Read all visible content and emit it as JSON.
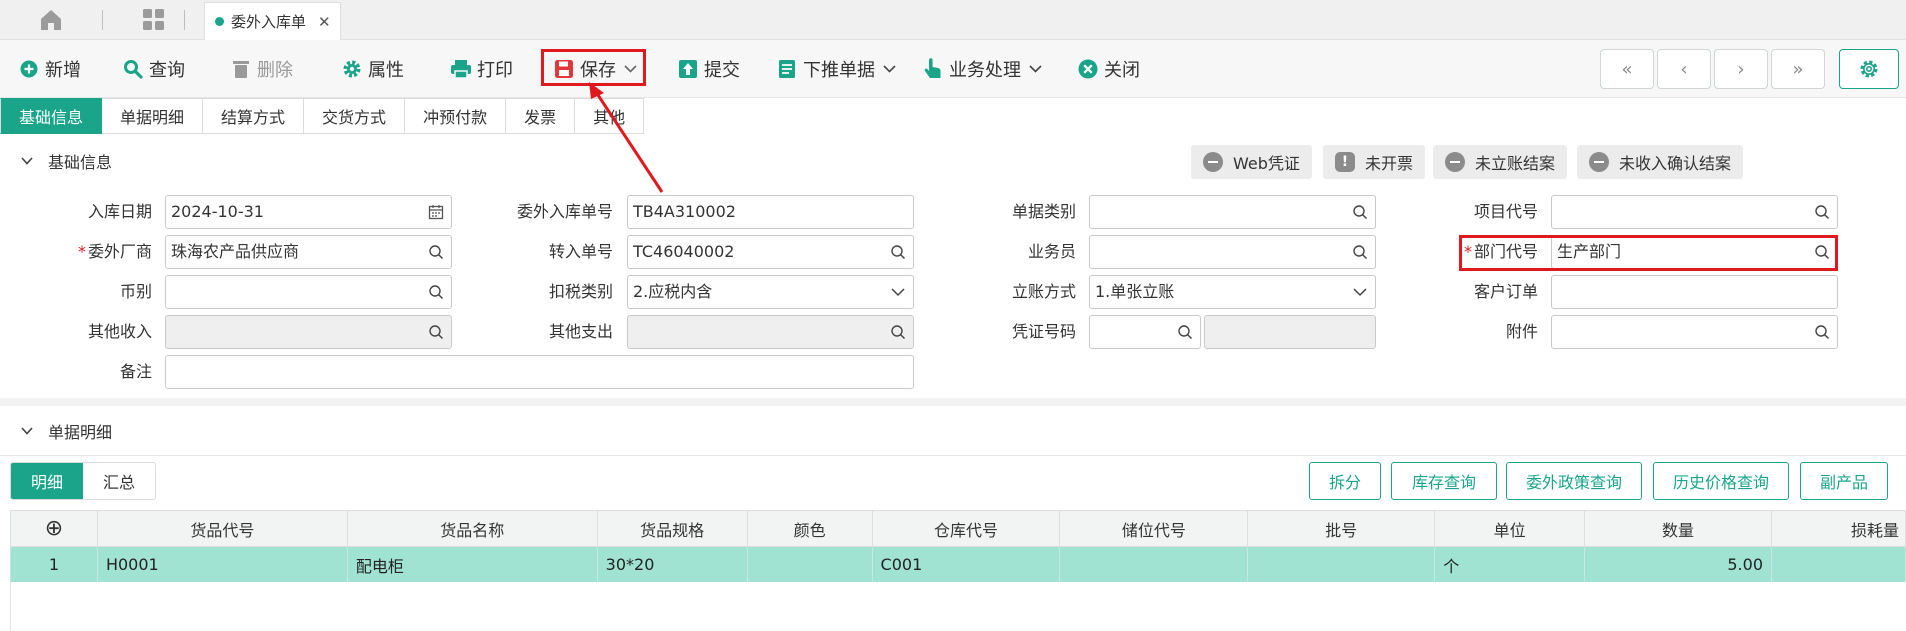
{
  "topbar": {
    "doc_tab_label": "委外入库单",
    "close_glyph": "✕"
  },
  "toolbar": {
    "buttons": [
      {
        "label": "新增",
        "icon": "plus-circle-icon"
      },
      {
        "label": "查询",
        "icon": "search-icon"
      },
      {
        "label": "删除",
        "icon": "trash-icon"
      },
      {
        "label": "属性",
        "icon": "gear-icon"
      },
      {
        "label": "打印",
        "icon": "printer-icon"
      },
      {
        "label": "保存",
        "icon": "save-icon"
      },
      {
        "label": "提交",
        "icon": "upload-icon"
      },
      {
        "label": "下推单据",
        "icon": "document-icon"
      },
      {
        "label": "业务处理",
        "icon": "hand-pointer-icon"
      },
      {
        "label": "关闭",
        "icon": "close-circle-icon"
      }
    ],
    "nav": [
      "«",
      "‹",
      "›",
      "»"
    ]
  },
  "subtabs": [
    "基础信息",
    "单据明细",
    "结算方式",
    "交货方式",
    "冲预付款",
    "发票",
    "其他"
  ],
  "basic": {
    "section_title": "基础信息",
    "status_buttons": [
      "Web凭证",
      "未开票",
      "未立账结案",
      "未收入确认结案"
    ],
    "fields": {
      "ruku_date": {
        "label": "入库日期",
        "value": "2024-10-31"
      },
      "order_no": {
        "label": "委外入库单号",
        "value": "TB4A310002"
      },
      "doc_type": {
        "label": "单据类别",
        "value": ""
      },
      "project": {
        "label": "项目代号",
        "value": ""
      },
      "vendor": {
        "label": "委外厂商",
        "value": "珠海农产品供应商"
      },
      "transfer_no": {
        "label": "转入单号",
        "value": "TC46040002"
      },
      "salesman": {
        "label": "业务员",
        "value": ""
      },
      "dept": {
        "label": "部门代号",
        "value": "生产部门"
      },
      "currency": {
        "label": "币别",
        "value": ""
      },
      "tax_type": {
        "label": "扣税类别",
        "value": "2.应税内含"
      },
      "account_mode": {
        "label": "立账方式",
        "value": "1.单张立账"
      },
      "customer_order": {
        "label": "客户订单",
        "value": ""
      },
      "other_income": {
        "label": "其他收入",
        "value": ""
      },
      "other_expense": {
        "label": "其他支出",
        "value": ""
      },
      "voucher_no": {
        "label": "凭证号码",
        "value": ""
      },
      "attachment": {
        "label": "附件",
        "value": ""
      },
      "remark": {
        "label": "备注",
        "value": ""
      }
    },
    "required_mark": "*"
  },
  "detail": {
    "section_title": "单据明细",
    "tabs": [
      "明细",
      "汇总"
    ],
    "actions": [
      "拆分",
      "库存查询",
      "委外政策查询",
      "历史价格查询",
      "副产品"
    ],
    "columns": [
      "货品代号",
      "货品名称",
      "货品规格",
      "颜色",
      "仓库代号",
      "储位代号",
      "批号",
      "单位",
      "数量",
      "损耗量"
    ],
    "add_col_glyph": "⊕",
    "rows": [
      {
        "idx": "1",
        "code": "H0001",
        "name": "配电柜",
        "spec": "30*20",
        "color": "",
        "warehouse": "C001",
        "location": "",
        "batch": "",
        "unit": "个",
        "qty": "5.00",
        "loss": ""
      }
    ]
  },
  "colors": {
    "accent": "#1aa58b",
    "highlight": "#e0191c",
    "row_selected": "#a0e3d2"
  }
}
